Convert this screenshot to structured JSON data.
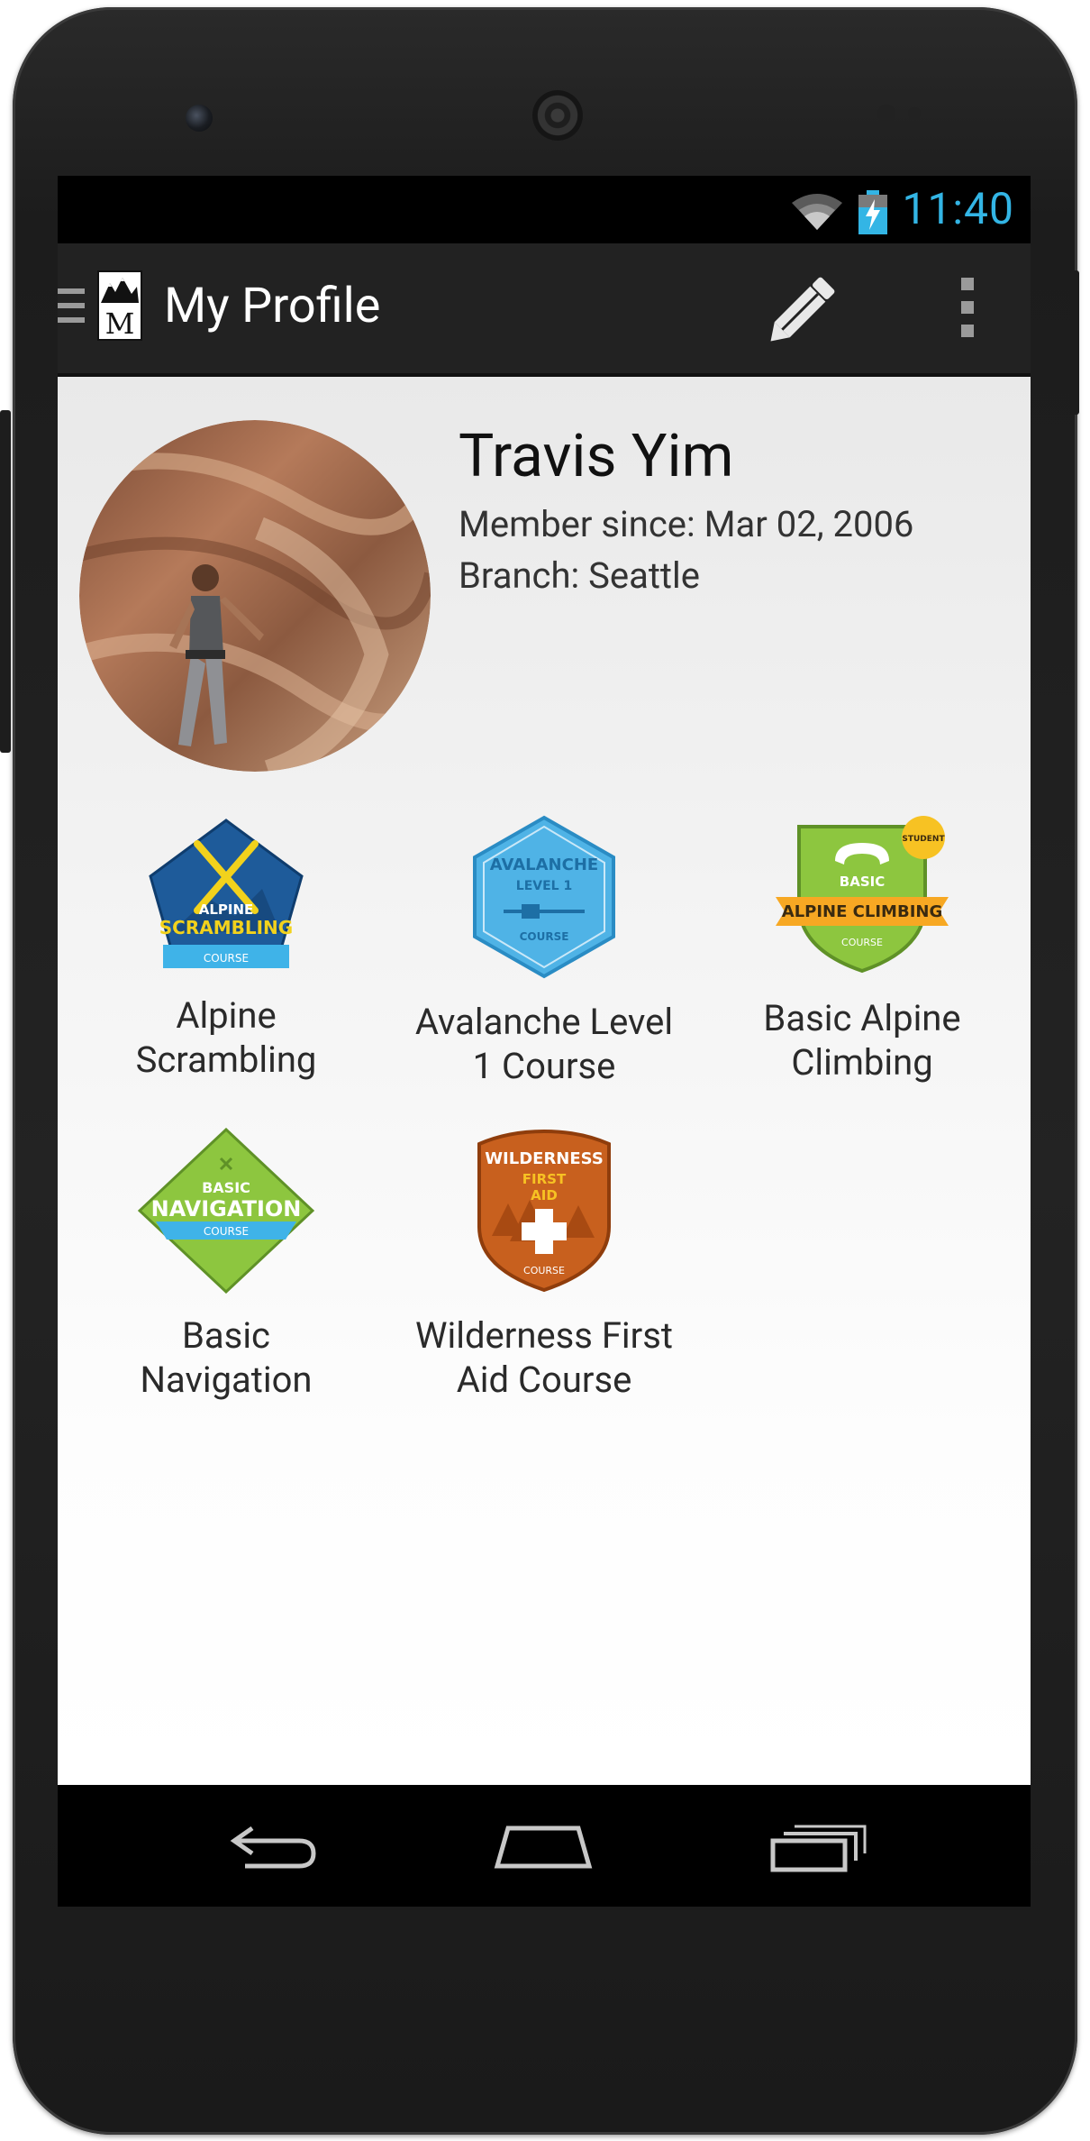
{
  "status_bar": {
    "time": "11:40",
    "icons": [
      "wifi-icon",
      "battery-charging-icon"
    ],
    "time_color": "#33b5e5"
  },
  "action_bar": {
    "title": "My Profile",
    "logo_letter": "M",
    "icons": [
      "navigation-drawer-icon",
      "app-logo-icon",
      "edit-pencil-icon",
      "overflow-menu-icon"
    ]
  },
  "profile": {
    "name": "Travis Yim",
    "member_since": "Member since: Mar 02, 2006",
    "branch": "Branch: Seattle"
  },
  "badges": [
    {
      "label": "Alpine\nScrambling",
      "badge_text": [
        "ALPINE",
        "SCRAMBLING",
        "COURSE"
      ],
      "color": "#1e5b9a"
    },
    {
      "label": "Avalanche Level\n1 Course",
      "badge_text": [
        "AVALANCHE",
        "LEVEL 1",
        "COURSE"
      ],
      "color": "#4fb3e6"
    },
    {
      "label": "Basic Alpine\nClimbing",
      "badge_text": [
        "BASIC",
        "ALPINE CLIMBING",
        "COURSE",
        "STUDENT"
      ],
      "color": "#8dc63f"
    },
    {
      "label": "Basic\nNavigation",
      "badge_text": [
        "BASIC",
        "NAVIGATION",
        "COURSE"
      ],
      "color": "#8dc63f"
    },
    {
      "label": "Wilderness First\nAid Course",
      "badge_text": [
        "WILDERNESS",
        "FIRST",
        "AID",
        "COURSE"
      ],
      "color": "#c8601e"
    }
  ],
  "nav_bar": {
    "buttons": [
      "back-icon",
      "home-icon",
      "recent-apps-icon"
    ]
  }
}
